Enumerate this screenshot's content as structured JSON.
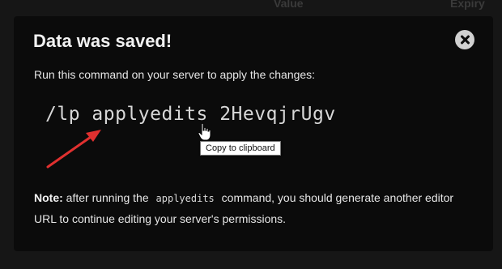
{
  "background_table": {
    "value_header": "Value",
    "expiry_header": "Expiry"
  },
  "modal": {
    "title": "Data was saved!",
    "instruction": "Run this command on your server to apply the changes:",
    "command": "/lp applyedits 2HevqjrUgv",
    "tooltip": "Copy to clipboard",
    "note": {
      "label": "Note:",
      "text_before": " after running the ",
      "code": "applyedits",
      "text_after": " command, you should generate another editor URL to continue editing your server's permissions."
    },
    "close_icon": "close-icon"
  },
  "colors": {
    "page_background": "#161616",
    "modal_background": "#0b0b0b",
    "arrow": "#e0302f",
    "close_button": "#d0d0d0"
  }
}
